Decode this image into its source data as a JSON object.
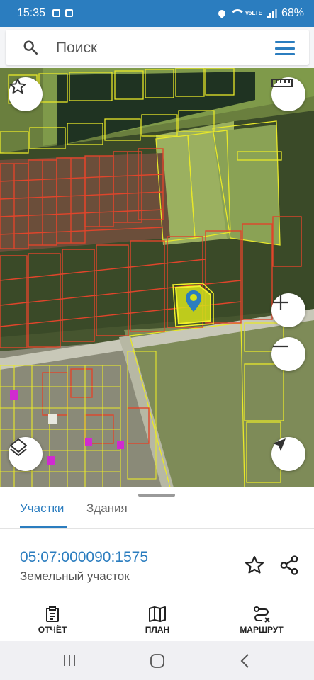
{
  "status_bar": {
    "time": "15:35",
    "battery": "68%",
    "network": "VoLTE",
    "icons": [
      "notification-box-icon",
      "notification-box-icon",
      "location-icon",
      "wifi-icon",
      "volte-icon",
      "signal-icon",
      "battery-icon"
    ]
  },
  "search": {
    "placeholder": "Поиск",
    "icon": "search-icon",
    "menu_icon": "hamburger-menu-icon"
  },
  "map_controls": {
    "favorites": "star-icon",
    "ruler": "ruler-icon",
    "zoom_in": "plus-icon",
    "zoom_out": "minus-icon",
    "layers": "layers-icon",
    "locate": "navigation-arrow-icon",
    "marker": "map-pin-icon"
  },
  "tabs": [
    {
      "label": "Участки",
      "active": true
    },
    {
      "label": "Здания",
      "active": false
    }
  ],
  "parcel": {
    "cadastral_number": "05:07:000090:1575",
    "type": "Земельный участок"
  },
  "bottom_nav": [
    {
      "label": "ОТЧЁТ",
      "icon": "report-icon"
    },
    {
      "label": "ПЛАН",
      "icon": "map-plan-icon"
    },
    {
      "label": "МАРШРУТ",
      "icon": "route-icon"
    }
  ],
  "colors": {
    "accent": "#2b7dbf",
    "parcel_border_red": "#e0452b",
    "parcel_border_yellow": "#e8e82a",
    "selected_parcel_fill": "#d6e21a"
  }
}
